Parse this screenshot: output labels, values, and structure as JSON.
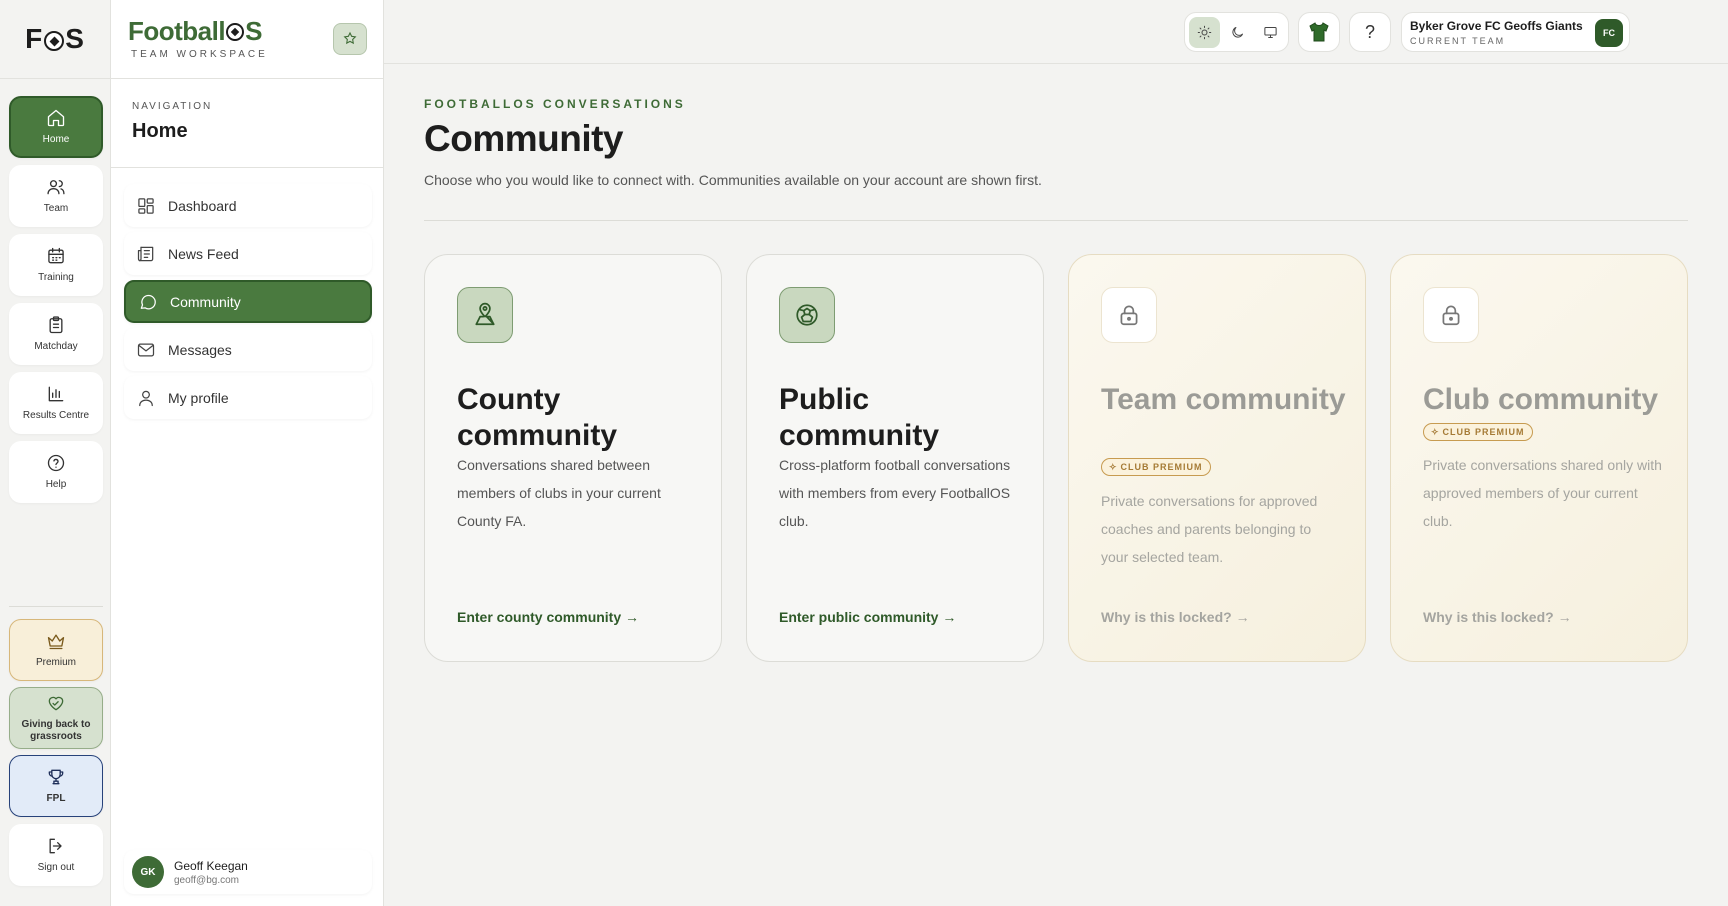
{
  "rail": {
    "logo": {
      "left": "F",
      "right": "S"
    },
    "items": [
      {
        "label": "Home",
        "icon": "home-icon"
      },
      {
        "label": "Team",
        "icon": "team-icon"
      },
      {
        "label": "Training",
        "icon": "calendar-icon"
      },
      {
        "label": "Matchday",
        "icon": "clipboard-icon"
      },
      {
        "label": "Results Centre",
        "icon": "bar-chart-icon"
      },
      {
        "label": "Help",
        "icon": "help-icon"
      }
    ],
    "bottom": [
      {
        "label": "Premium",
        "icon": "crown-icon"
      },
      {
        "label": "Giving back to grassroots",
        "icon": "heart-handshake-icon"
      },
      {
        "label": "FPL",
        "icon": "trophy-icon"
      },
      {
        "label": "Sign out",
        "icon": "sign-out-icon"
      }
    ],
    "active": "Home"
  },
  "brand": {
    "name_left": "Football",
    "name_right": "S",
    "subtitle": "TEAM WORKSPACE"
  },
  "nav": {
    "label": "NAVIGATION",
    "title": "Home",
    "items": [
      {
        "label": "Dashboard",
        "icon": "dashboard-icon"
      },
      {
        "label": "News Feed",
        "icon": "newspaper-icon"
      },
      {
        "label": "Community",
        "icon": "chat-bubble-icon"
      },
      {
        "label": "Messages",
        "icon": "mail-icon"
      },
      {
        "label": "My profile",
        "icon": "user-icon"
      }
    ],
    "active": "Community"
  },
  "user": {
    "initials": "GK",
    "name": "Geoff Keegan",
    "email": "geoff@bg.com"
  },
  "topbar": {
    "theme_modes": [
      "light",
      "dark",
      "system"
    ],
    "theme_active": "light",
    "help_label": "?",
    "team": {
      "name": "Byker Grove FC Geoffs Giants",
      "subtitle": "CURRENT TEAM",
      "badge": "FC"
    }
  },
  "page": {
    "eyebrow": "FOOTBALLOS CONVERSATIONS",
    "title": "Community",
    "description": "Choose who you would like to connect with. Communities available on your account are shown first."
  },
  "cards": [
    {
      "title": "County community",
      "description": "Conversations shared between members of clubs in your current County FA.",
      "link": "Enter county community →",
      "locked": false,
      "badge": "",
      "icon": "map-pin-icon"
    },
    {
      "title": "Public community",
      "description": "Cross-platform football conversations with members from every FootballOS club.",
      "link": "Enter public community →",
      "locked": false,
      "badge": "",
      "icon": "globe-ball-icon"
    },
    {
      "title": "Team community",
      "description": "Private conversations for approved coaches and parents belonging to your selected team.",
      "link": "Why is this locked? →",
      "locked": true,
      "badge": "CLUB PREMIUM",
      "icon": "lock-icon"
    },
    {
      "title": "Club community",
      "description": "Private conversations shared only with approved members of your current club.",
      "link": "Why is this locked? →",
      "locked": true,
      "badge": "CLUB PREMIUM",
      "icon": "lock-icon"
    }
  ],
  "colors": {
    "accent": "#4a7a3f",
    "accent_dark": "#2f5a29",
    "premium": "#c79b50",
    "background": "#f3f3f1"
  }
}
